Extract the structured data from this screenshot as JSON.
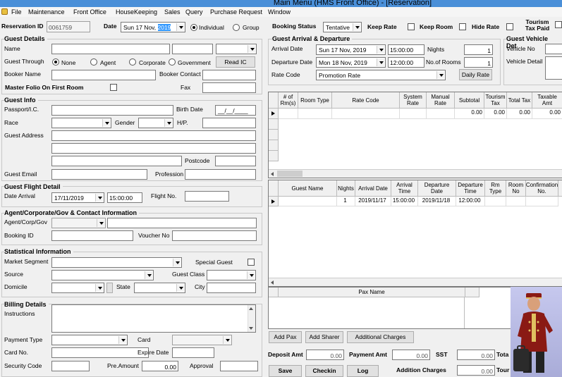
{
  "window": {
    "title": "Main Menu (HMS Front Office) - [Reservation]"
  },
  "menu": [
    "File",
    "Maintenance",
    "Front Office",
    "HouseKeeping",
    "Sales",
    "Query",
    "Purchase Request",
    "Window"
  ],
  "header": {
    "reservation_id_label": "Reservation ID",
    "reservation_id": "0061759",
    "date_label": "Date",
    "date_day": "Sun 17 Nov, ",
    "date_year": "2019",
    "individual": "Individual",
    "group": "Group",
    "booking_status_label": "Booking Status",
    "booking_status": "Tentative",
    "keep_rate": "Keep Rate",
    "keep_room": "Keep Room",
    "hide_rate": "Hide Rate",
    "tourism_tax_paid": "Tourism Tax Paid"
  },
  "guest_details": {
    "title": "Guest Details",
    "name": "Name",
    "guest_through": "Guest Through",
    "none": "None",
    "agent": "Agent",
    "corporate": "Corporate",
    "government": "Government",
    "read_ic": "Read IC",
    "booker_name": "Booker Name",
    "booker_contact": "Booker Contact",
    "master_folio": "Master Folio On First Room",
    "fax": "Fax"
  },
  "guest_info": {
    "title": "Guest Info",
    "passport": "Passport/I.C.",
    "birth_date": "Birth Date",
    "birth_date_value": "__/__/____",
    "race": "Race",
    "gender": "Gender",
    "hp": "H/P.",
    "address": "Guest Address",
    "postcode": "Postcode",
    "email": "Guest Email",
    "profession": "Profession"
  },
  "flight": {
    "title": "Guest Flight Detail",
    "date_arrival": "Date Arrival",
    "date_value": "17/11/2019",
    "time_value": "15:00:00",
    "flight_no": "Flight No."
  },
  "agent_info": {
    "title": "Agent/Corporate/Gov & Contact Information",
    "agent_corp_gov": "Agent/Corp/Gov",
    "booking_id": "Booking ID",
    "voucher_no": "Voucher No"
  },
  "statistical": {
    "title": "Statistical Information",
    "market_segment": "Market Segment",
    "special_guest": "Special Guest",
    "source": "Source",
    "guest_class": "Guest Class",
    "domicile": "Domicile",
    "state": "State",
    "city": "City"
  },
  "billing": {
    "title": "Billing Details",
    "instructions": "Instructions",
    "payment_type": "Payment Type",
    "card": "Card",
    "card_no": "Card No.",
    "expire_date": "Expire Date",
    "security_code": "Security Code",
    "pre_amount": "Pre.Amount",
    "pre_amount_value": "0.00",
    "approval": "Approval"
  },
  "arrival": {
    "title": "Guest Arrival & Departure",
    "arrival_date": "Arrival Date",
    "arrival_value": "Sun 17 Nov, 2019",
    "arrival_time": "15:00:00",
    "nights": "Nights",
    "nights_value": "1",
    "departure_date": "Departure Date",
    "departure_value": "Mon 18 Nov, 2019",
    "departure_time": "12:00:00",
    "no_of_rooms": "No.of Rooms",
    "rooms_value": "1",
    "rate_code": "Rate Code",
    "rate_code_value": "Promotion Rate",
    "daily_rate": "Daily Rate"
  },
  "vehicle": {
    "title": "Guest Vehicle Det",
    "vehicle_no": "Vehicle No",
    "vehicle_detail": "Vehicle Detail"
  },
  "rate_grid": {
    "headers": [
      "# of Rm(s)",
      "Room Type",
      "Rate Code",
      "System Rate",
      "Manual Rate",
      "Subtotal",
      "Tourism Tax",
      "Total Tax",
      "Taxable Amt"
    ],
    "row": [
      "",
      "",
      "",
      "",
      "",
      "0.00",
      "0.00",
      "0.00",
      "0.00"
    ]
  },
  "guest_grid": {
    "headers": [
      "Guest Name",
      "Nights",
      "Arrival Date",
      "Arrival Time",
      "Departure Date",
      "Departure Time",
      "Rm Type",
      "Room No",
      "Confirmation No."
    ],
    "row": [
      "",
      "1",
      "2019/11/17",
      "15:00:00",
      "2019/11/18",
      "12:00:00",
      "",
      "",
      ""
    ]
  },
  "pax_grid": {
    "header": "Pax Name"
  },
  "actions": {
    "add_pax": "Add Pax",
    "add_sharer": "Add Sharer",
    "additional_charges": "Additional Charges",
    "save": "Save",
    "checkin": "Checkin",
    "log": "Log"
  },
  "totals": {
    "deposit_amt": "Deposit Amt",
    "deposit_value": "0.00",
    "payment_amt": "Payment Amt",
    "payment_value": "0.00",
    "sst": "SST",
    "sst_value": "0.00",
    "total": "Tota",
    "addition_charges": "Addition Charges",
    "addition_value": "0.00",
    "tour": "Tour"
  },
  "colors": {
    "titlebar": "#4a8fd8",
    "selection": "#3399ff"
  }
}
